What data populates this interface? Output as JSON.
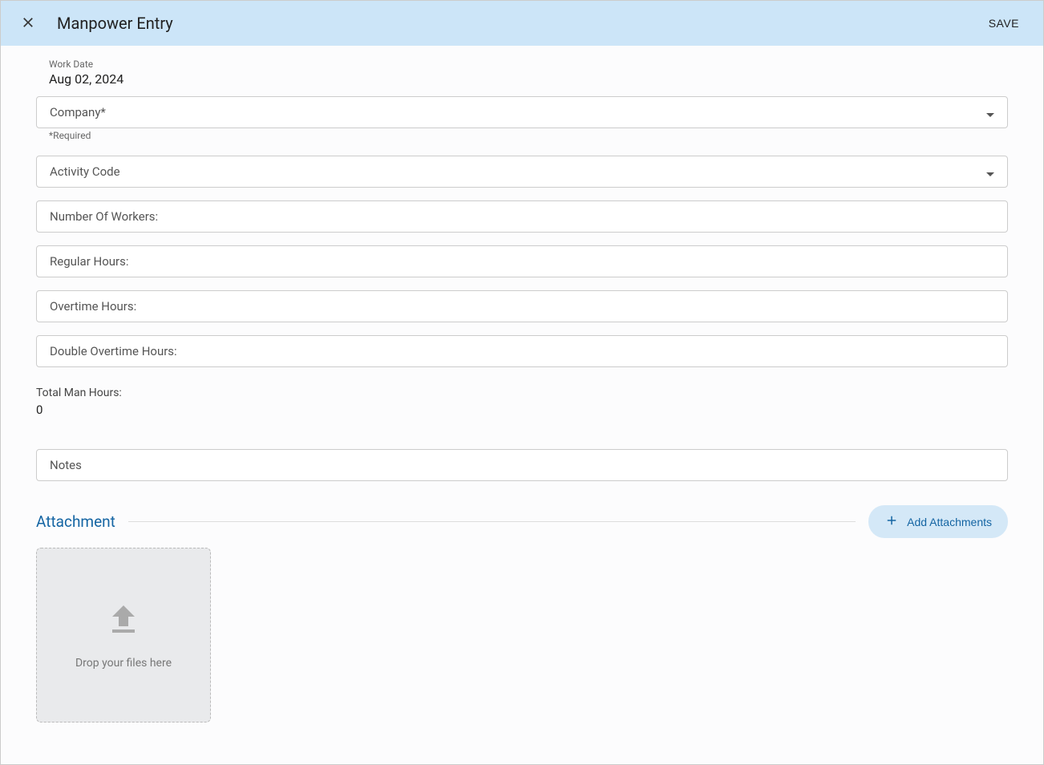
{
  "header": {
    "title": "Manpower Entry",
    "save_label": "SAVE"
  },
  "workDate": {
    "label": "Work Date",
    "value": "Aug 02, 2024"
  },
  "fields": {
    "company_label": "Company*",
    "company_helper": "*Required",
    "activity_code_label": "Activity Code",
    "workers_label": "Number Of Workers:",
    "regular_hours_label": "Regular Hours:",
    "overtime_hours_label": "Overtime Hours:",
    "double_overtime_label": "Double Overtime Hours:",
    "notes_label": "Notes"
  },
  "total": {
    "label": "Total Man Hours:",
    "value": "0"
  },
  "attachment": {
    "title": "Attachment",
    "add_label": "Add Attachments",
    "dropzone_text": "Drop your files here"
  }
}
